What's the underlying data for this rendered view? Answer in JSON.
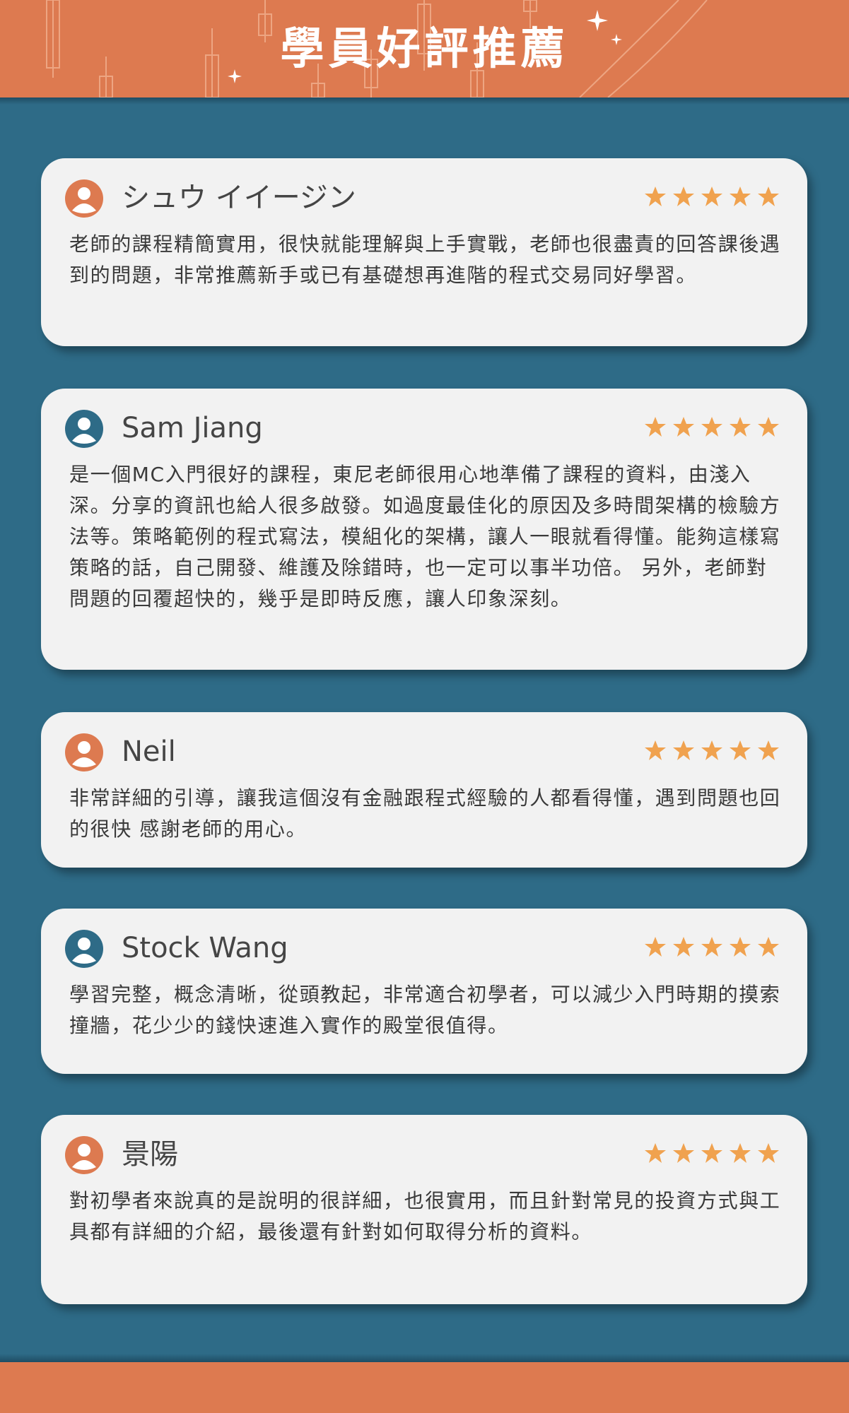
{
  "header": {
    "title": "學員好評推薦"
  },
  "colors": {
    "accent_orange": "#dd7a50",
    "background_blue": "#2e6b87",
    "card_bg": "#f2f2f2",
    "star": "#f0a24f"
  },
  "reviews": [
    {
      "name": "シュウ イイージン",
      "avatar_color": "#dd7a50",
      "rating": 5,
      "text": "老師的課程精簡實用，很快就能理解與上手實戰，老師也很盡責的回答課後遇到的問題，非常推薦新手或已有基礎想再進階的程式交易同好學習。"
    },
    {
      "name": "Sam Jiang",
      "avatar_color": "#2e6b87",
      "rating": 5,
      "text": "是一個MC入門很好的課程，東尼老師很用心地準備了課程的資料，由淺入深。分享的資訊也給人很多啟發。如過度最佳化的原因及多時間架構的檢驗方法等。策略範例的程式寫法，模組化的架構，讓人一眼就看得懂。能夠這樣寫策略的話，自己開發、維護及除錯時，也一定可以事半功倍。 另外，老師對問題的回覆超快的，幾乎是即時反應，讓人印象深刻。"
    },
    {
      "name": "Neil",
      "avatar_color": "#dd7a50",
      "rating": 5,
      "text": "非常詳細的引導，讓我這個沒有金融跟程式經驗的人都看得懂，遇到問題也回的很快 感謝老師的用心。"
    },
    {
      "name": "Stock Wang",
      "avatar_color": "#2e6b87",
      "rating": 5,
      "text": "學習完整，概念清晰，從頭教起，非常適合初學者，可以減少入門時期的摸索撞牆，花少少的錢快速進入實作的殿堂很值得。"
    },
    {
      "name": "景陽",
      "avatar_color": "#dd7a50",
      "rating": 5,
      "text": "對初學者來說真的是說明的很詳細，也很實用，而且針對常見的投資方式與工具都有詳細的介紹，最後還有針對如何取得分析的資料。"
    }
  ]
}
